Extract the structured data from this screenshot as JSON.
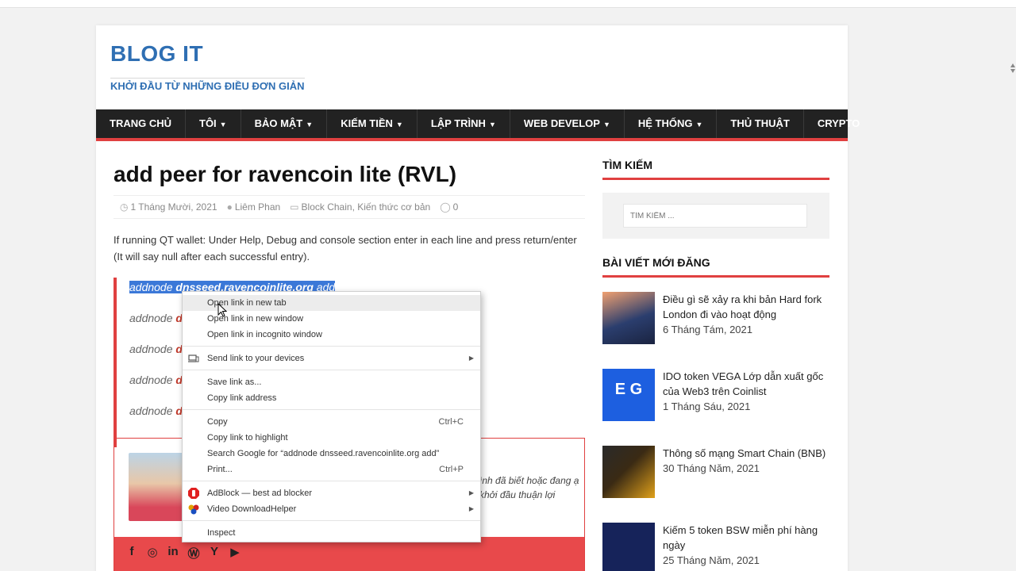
{
  "site": {
    "title": "BLOG IT",
    "tagline": "KHỞI ĐẦU TỪ NHỮNG ĐIỀU ĐƠN GIẢN"
  },
  "nav": [
    {
      "label": "TRANG CHỦ",
      "has_caret": false
    },
    {
      "label": "TÔI",
      "has_caret": true
    },
    {
      "label": "BẢO MẬT",
      "has_caret": true
    },
    {
      "label": "KIẾM TIỀN",
      "has_caret": true
    },
    {
      "label": "LẬP TRÌNH",
      "has_caret": true
    },
    {
      "label": "WEB DEVELOP",
      "has_caret": true
    },
    {
      "label": "HỆ THỐNG",
      "has_caret": true
    },
    {
      "label": "THỦ THUẬT",
      "has_caret": false
    },
    {
      "label": "CRYPTO",
      "has_caret": false
    }
  ],
  "post": {
    "title": "add peer for ravencoin lite (RVL)",
    "date": "1 Tháng Mười, 2021",
    "author": "Liêm Phan",
    "categories": "Block Chain, Kiến thức cơ bản",
    "comments": "0",
    "intro": "If running QT wallet: Under Help, Debug and console section enter in each line and press return/enter (It will say null after each successful entry).",
    "lines": [
      {
        "prefix": "addnode",
        "host": "dnsseed.ravencoinlite.org",
        "suffix": "add"
      },
      {
        "prefix": "addnode",
        "host": "d"
      },
      {
        "prefix": "addnode",
        "host": "dn"
      },
      {
        "prefix": "addnode",
        "host": "d"
      },
      {
        "prefix": "addnode",
        "host": "d"
      }
    ]
  },
  "author_box": {
    "text": "ình đã biết hoặc đang ạ khởi đầu thuận lợi"
  },
  "social_icons": [
    "facebook-icon",
    "instagram-icon",
    "linkedin-icon",
    "wordpress-icon",
    "hackernews-icon",
    "youtube-icon"
  ],
  "sidebar": {
    "search_title": "TÌM KIẾM",
    "search_placeholder": "TÌM KIẾM ...",
    "recent_title": "BÀI VIẾT MỚI ĐĂNG",
    "recent_posts": [
      {
        "title": "Điều gì sẽ xảy ra khi bản Hard fork London đi vào hoạt động",
        "date": "6 Tháng Tám, 2021"
      },
      {
        "title": "IDO token VEGA Lớp dẫn xuất gốc của Web3 trên Coinlist",
        "date": "1 Tháng Sáu, 2021"
      },
      {
        "title": "Thông số mạng Smart Chain (BNB)",
        "date": "30 Tháng Năm, 2021"
      },
      {
        "title": "Kiếm 5 token BSW miễn phí hàng ngày",
        "date": "25 Tháng Năm, 2021"
      }
    ]
  },
  "context_menu": {
    "open_new_tab": "Open link in new tab",
    "open_new_window": "Open link in new window",
    "open_incognito": "Open link in incognito window",
    "send_to_devices": "Send link to your devices",
    "save_link_as": "Save link as...",
    "copy_link_address": "Copy link address",
    "copy": "Copy",
    "copy_shortcut": "Ctrl+C",
    "copy_link_highlight": "Copy link to highlight",
    "search_google": "Search Google for “addnode dnsseed.ravencoinlite.org add”",
    "print": "Print...",
    "print_shortcut": "Ctrl+P",
    "adblock": "AdBlock — best ad blocker",
    "video_dl": "Video DownloadHelper",
    "inspect": "Inspect"
  },
  "colors": {
    "brand_blue": "#2f6fb3",
    "accent_red": "#e04040",
    "nav_bg": "#222222",
    "selection": "#3b78d8"
  }
}
